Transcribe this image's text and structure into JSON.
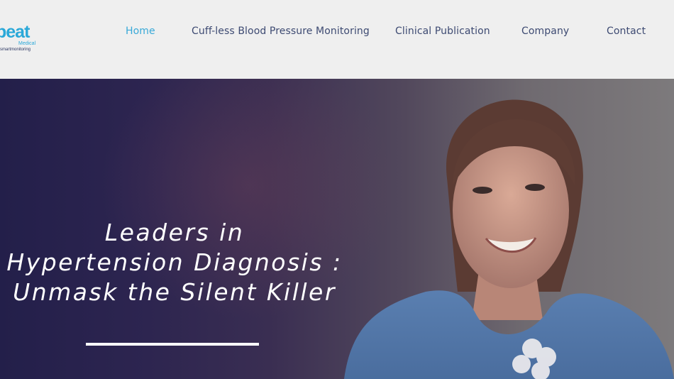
{
  "brand": {
    "logo_word": "beat",
    "logo_sub1": "Medical",
    "logo_sub2": "smartmonitoring"
  },
  "nav": {
    "items": [
      {
        "label": "Home",
        "active": true
      },
      {
        "label": "Cuff-less Blood Pressure Monitoring",
        "active": false
      },
      {
        "label": "Clinical Publication",
        "active": false
      },
      {
        "label": "Company",
        "active": false
      },
      {
        "label": "Contact",
        "active": false
      }
    ]
  },
  "hero": {
    "headline_lines": [
      "Leaders in",
      "Hypertension Diagnosis :",
      "Unmask the Silent Killer"
    ]
  },
  "colors": {
    "accent": "#38a9d8",
    "nav_text": "#3d4a72",
    "hero_dark": "#231f4a"
  }
}
